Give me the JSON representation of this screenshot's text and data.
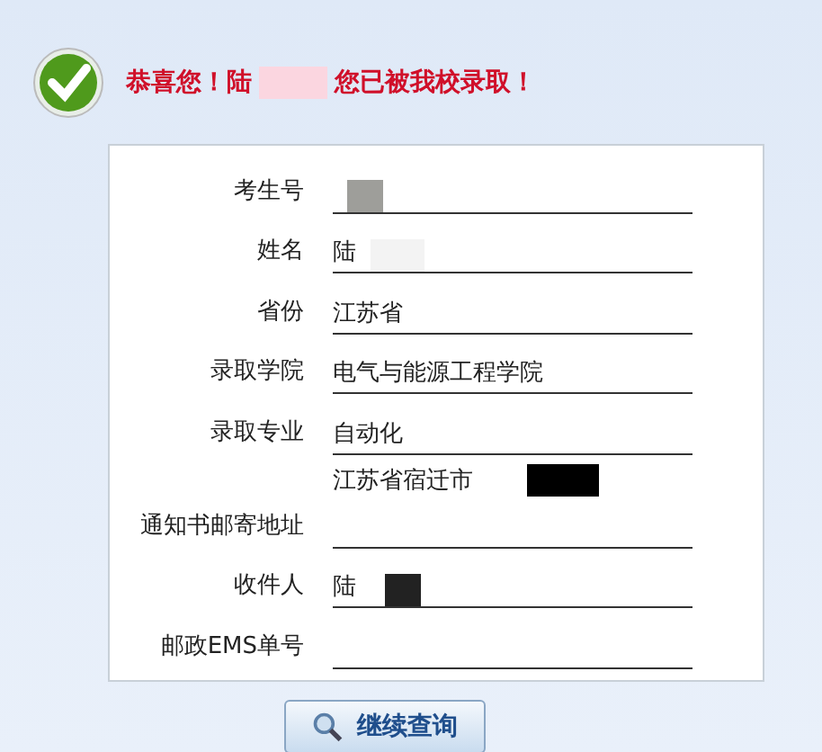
{
  "header": {
    "greeting": "恭喜您！陆",
    "message": "您已被我校录取！"
  },
  "fields": [
    {
      "label": "考生号",
      "redacted": true
    },
    {
      "label": "姓名",
      "value": "陆",
      "redacted": true
    },
    {
      "label": "省份",
      "value": "江苏省"
    },
    {
      "label": "录取学院",
      "value": "电气与能源工程学院"
    },
    {
      "label": "录取专业",
      "value": "自动化"
    },
    {
      "label": "通知书邮寄地址",
      "value": "江苏省宿迁市",
      "redacted": true
    },
    {
      "label": "收件人",
      "value": "陆",
      "redacted": true
    },
    {
      "label": "邮政EMS单号"
    }
  ],
  "button": "继续查询"
}
